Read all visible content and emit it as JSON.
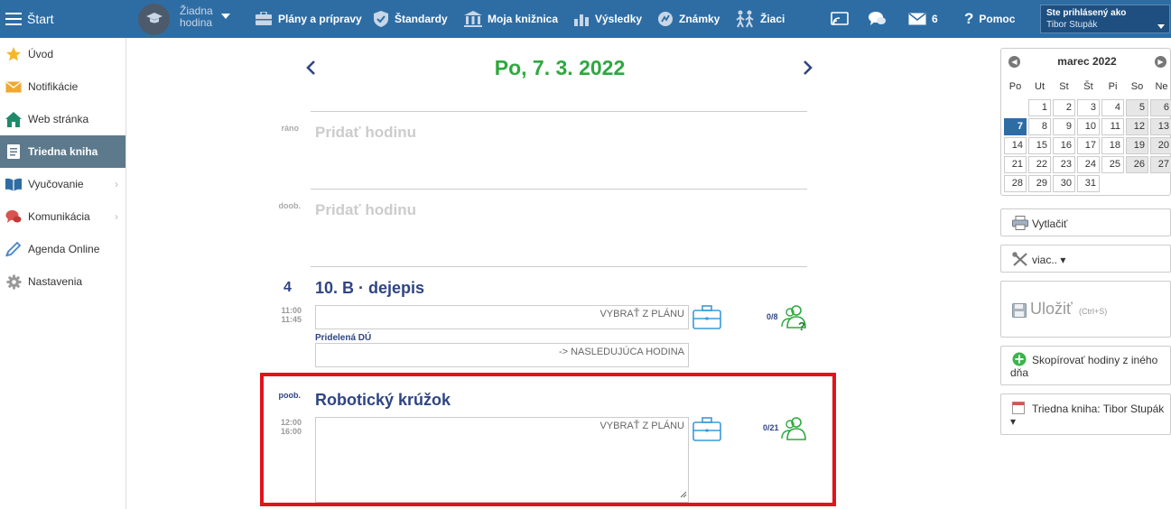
{
  "topbar": {
    "start_label": "Štart",
    "hodina_label": "Žiadna hodina",
    "nav": [
      {
        "label": "Plány a prípravy",
        "icon": "plans-icon"
      },
      {
        "label": "Štandardy",
        "icon": "shield-icon"
      },
      {
        "label": "Moja knižnica",
        "icon": "library-icon"
      },
      {
        "label": "Výsledky",
        "icon": "results-chart-icon"
      },
      {
        "label": "Známky",
        "icon": "grades-icon"
      },
      {
        "label": "Žiaci",
        "icon": "students-icon"
      }
    ],
    "messages_count": "6",
    "help_label": "Pomoc",
    "login_label": "Ste prihlásený ako",
    "user_name": "Tibor Stupák"
  },
  "sidebar": {
    "items": [
      {
        "label": "Úvod",
        "icon": "star-icon"
      },
      {
        "label": "Notifikácie",
        "icon": "envelope-icon"
      },
      {
        "label": "Web stránka",
        "icon": "home-icon"
      },
      {
        "label": "Triedna kniha",
        "icon": "classbook-icon"
      },
      {
        "label": "Vyučovanie",
        "icon": "book-open-icon"
      },
      {
        "label": "Komunikácia",
        "icon": "chat-icon"
      },
      {
        "label": "Agenda Online",
        "icon": "pencil-icon"
      },
      {
        "label": "Nastavenia",
        "icon": "gear-icon"
      }
    ]
  },
  "main": {
    "date": "Po, 7. 3. 2022",
    "slots": [
      {
        "label": "ráno",
        "add": "Pridať hodinu"
      },
      {
        "label": "doob.",
        "add": "Pridať hodinu"
      }
    ],
    "lesson1": {
      "number": "4",
      "title": "10. B · dejepis",
      "time_start": "11:00",
      "time_end": "11:45",
      "plan_button": "VYBRAŤ Z PLÁNU",
      "hw_label": "Pridelená DÚ",
      "hw_next": "-> NASLEDUJÚCA HODINA",
      "attendance": "0/8",
      "question_mark": "?"
    },
    "lesson2": {
      "slot": "poob.",
      "title": "Robotický krúžok",
      "time_start": "12:00",
      "time_end": "16:00",
      "plan_button": "VYBRAŤ Z PLÁNU",
      "attendance": "0/21"
    }
  },
  "calendar": {
    "title": "marec 2022",
    "dow": [
      "Po",
      "Ut",
      "St",
      "Št",
      "Pi",
      "So",
      "Ne"
    ],
    "first_weekday_offset": 1,
    "days_in_month": 31,
    "selected_day": 7
  },
  "right_panel": {
    "print_label": "Vytlačiť",
    "more_label": "viac.. ▾",
    "save_label": "Uložiť",
    "save_shortcut": "(Ctrl+S)",
    "copy_label": "Skopírovať hodiny z iného dňa",
    "classbook_label": "Triedna kniha: Tibor Stupák ▾"
  },
  "colors": {
    "topbar": "#2e6da4",
    "date_green": "#2ea83f",
    "lesson_blue": "#2f4583",
    "highlight_red": "#e0141b"
  }
}
